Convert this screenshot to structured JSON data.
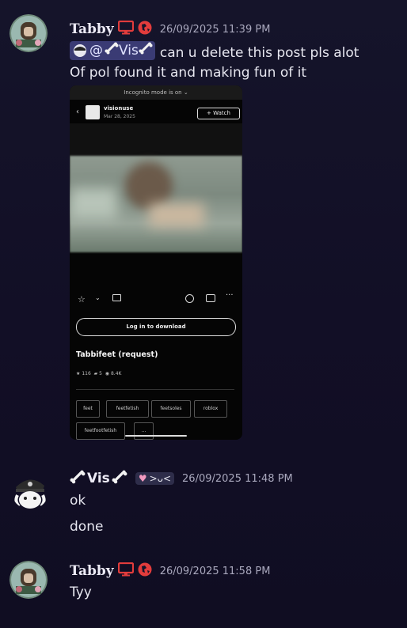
{
  "messages": [
    {
      "author": "Tabby",
      "timestamp": "26/09/2025 11:39 PM",
      "mention_name": "Vis",
      "line1": "can u delete this post pls alot",
      "line2": "Of pol found it and making fun of it"
    },
    {
      "author": "Vis",
      "tag": ">ᴗ<",
      "timestamp": "26/09/2025 11:48 PM",
      "lines": [
        "ok",
        "done"
      ]
    },
    {
      "author": "Tabby",
      "timestamp": "26/09/2025 11:58 PM",
      "line1": "Tyy"
    }
  ],
  "screenshot": {
    "incognito_text": "Incognito mode is on ⌄",
    "username": "visionuse",
    "date": "Mar 28, 2025",
    "watch_label": "+ Watch",
    "login_button": "Log in to download",
    "post_title": "Tabbifeet (request)",
    "stats": {
      "favorites": "116",
      "comments": "5",
      "views": "8.4K"
    },
    "tags": [
      "feet",
      "feetfetish",
      "feetsoles",
      "roblox",
      "feetfootfetish",
      "..."
    ]
  },
  "colors": {
    "accent_red": "#e23c3c",
    "mention_bg": "#3a3b74",
    "bg": "#15142a"
  }
}
